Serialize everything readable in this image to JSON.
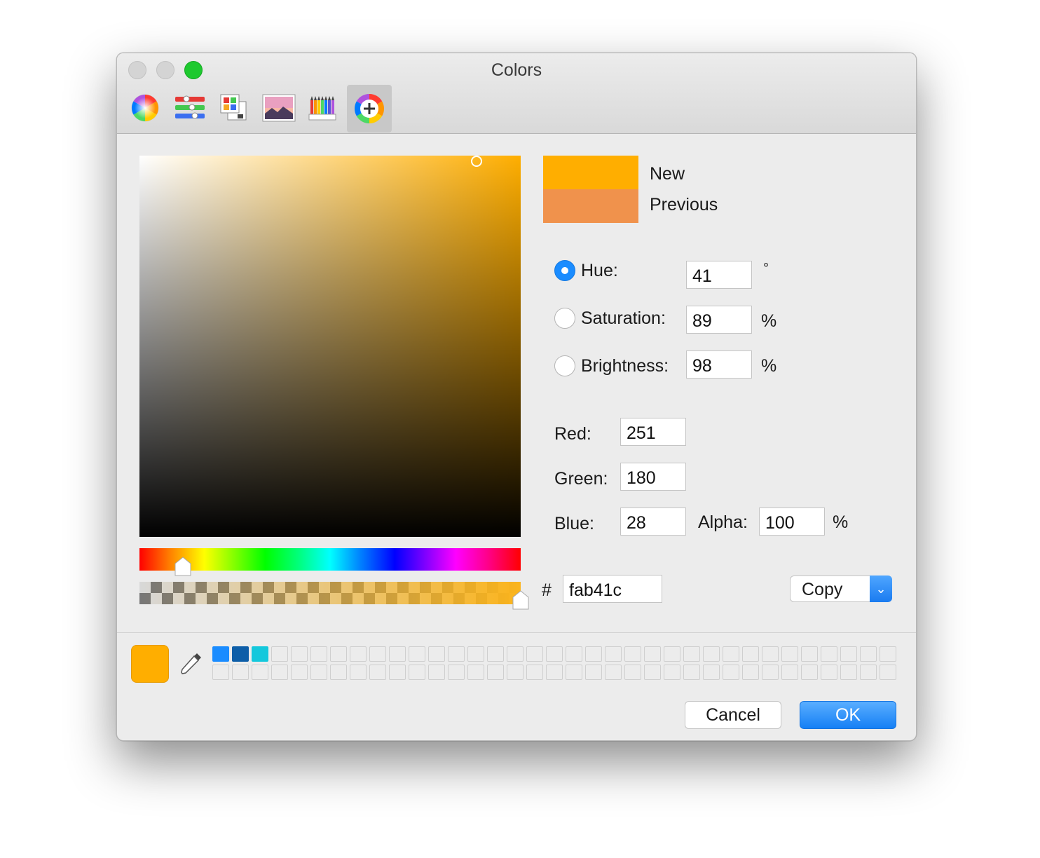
{
  "window": {
    "title": "Colors"
  },
  "toolbar": {
    "tools": [
      {
        "name": "color-wheel"
      },
      {
        "name": "color-sliders"
      },
      {
        "name": "color-palettes"
      },
      {
        "name": "image-palettes"
      },
      {
        "name": "pencils"
      },
      {
        "name": "custom-picker",
        "selected": true
      }
    ]
  },
  "picker": {
    "hue_position": 0.114,
    "alpha": 1.0
  },
  "swatches": {
    "new_label": "New",
    "previous_label": "Previous",
    "new_color": "#ffae00",
    "previous_color": "#f0924c"
  },
  "hsb": {
    "hue_label": "Hue:",
    "hue_value": "41",
    "hue_unit": "°",
    "saturation_label": "Saturation:",
    "saturation_value": "89",
    "saturation_unit": "%",
    "brightness_label": "Brightness:",
    "brightness_value": "98",
    "brightness_unit": "%",
    "selected_mode": "hue"
  },
  "rgb": {
    "red_label": "Red:",
    "red_value": "251",
    "green_label": "Green:",
    "green_value": "180",
    "blue_label": "Blue:",
    "blue_value": "28",
    "alpha_label": "Alpha:",
    "alpha_value": "100",
    "alpha_unit": "%"
  },
  "hex": {
    "prefix": "#",
    "value": "fab41c",
    "copy_label": "Copy"
  },
  "bottom": {
    "current_color": "#ffae00",
    "palette_colors": [
      "#1a8cff",
      "#0d5ea8",
      "#14c8dc"
    ],
    "cancel_label": "Cancel",
    "ok_label": "OK"
  },
  "colors": {
    "accent": "#1a8cff",
    "traffic_zoom": "#1ec92f"
  }
}
